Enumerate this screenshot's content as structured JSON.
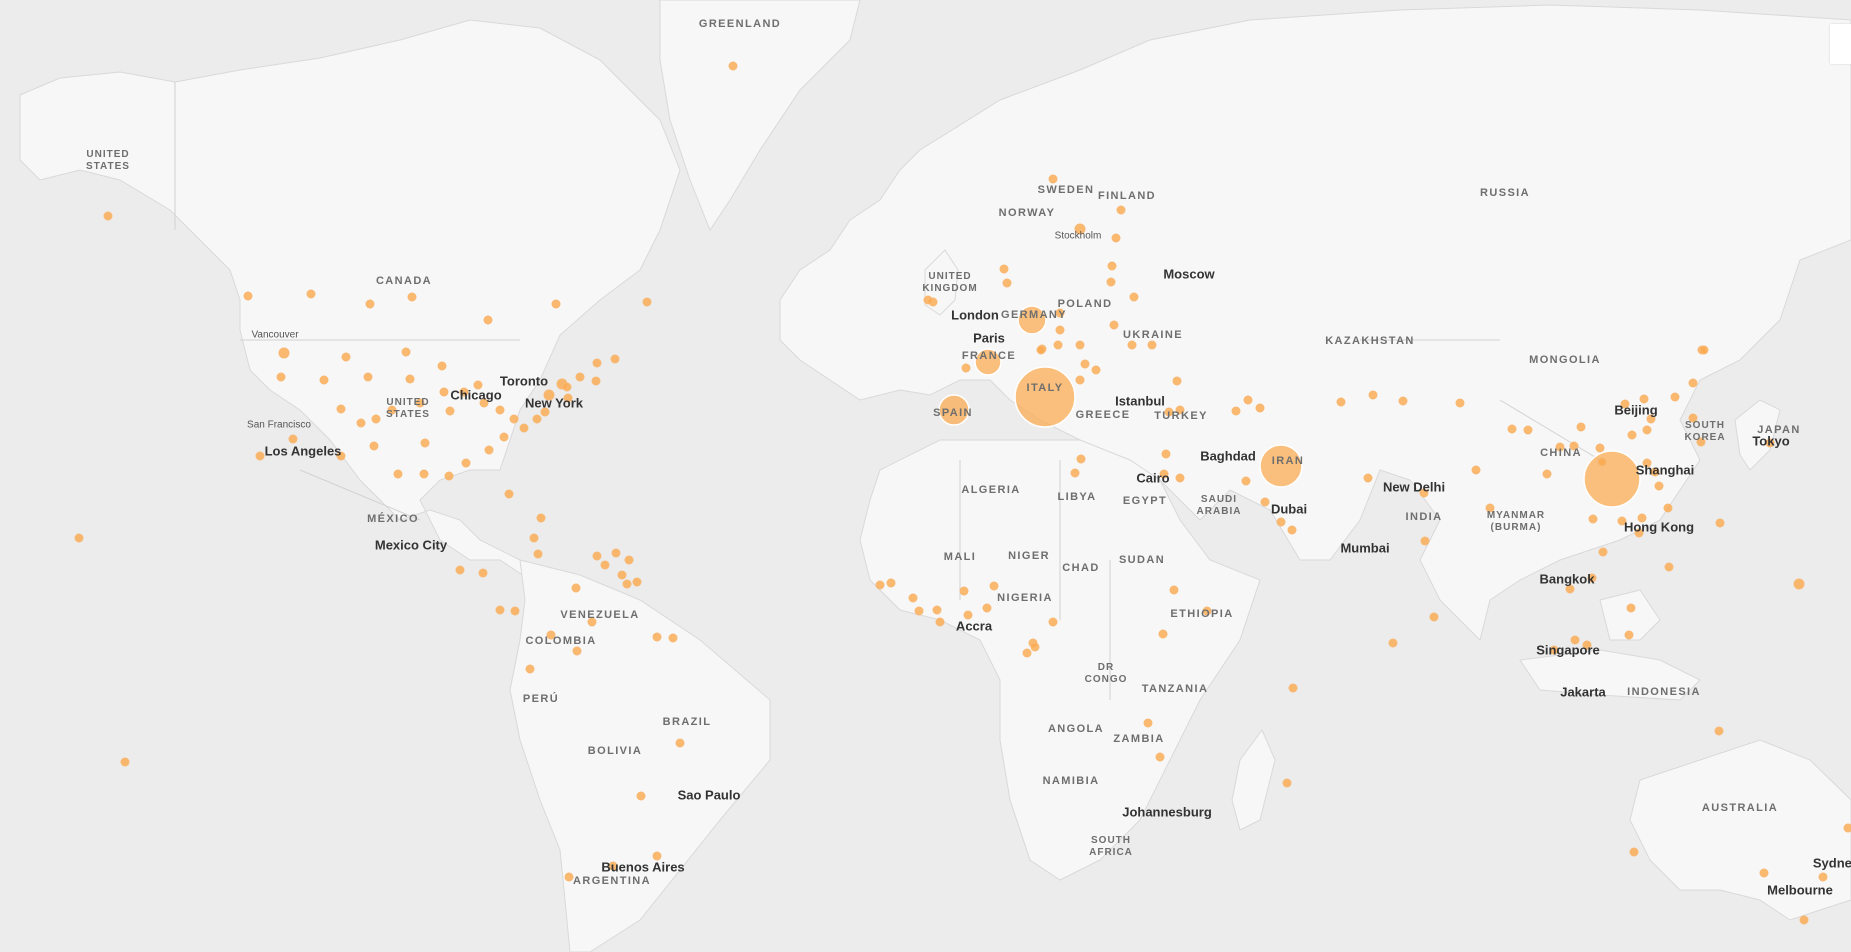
{
  "map": {
    "country_labels": [
      "GREENLAND",
      "UNITED\nSTATES",
      "CANADA",
      "UNITED\nSTATES",
      "MÉXICO",
      "VENEZUELA",
      "COLOMBIA",
      "PERÚ",
      "BRAZIL",
      "BOLIVIA",
      "ARGENTINA",
      "SWEDEN",
      "FINLAND",
      "NORWAY",
      "UNITED\nKINGDOM",
      "GERMANY",
      "POLAND",
      "UKRAINE",
      "FRANCE",
      "SPAIN",
      "ITALY",
      "GREECE",
      "TURKEY",
      "RUSSIA",
      "KAZAKHSTAN",
      "MONGOLIA",
      "IRAN",
      "ALGERIA",
      "LIBYA",
      "EGYPT",
      "SAUDI\nARABIA",
      "MALI",
      "NIGER",
      "CHAD",
      "SUDAN",
      "NIGERIA",
      "ETHIOPIA",
      "DR\nCONGO",
      "TANZANIA",
      "ANGOLA",
      "ZAMBIA",
      "NAMIBIA",
      "SOUTH\nAFRICA",
      "INDIA",
      "CHINA",
      "SOUTH\nKOREA",
      "JAPAN",
      "MYANMAR\n(BURMA)",
      "INDONESIA",
      "AUSTRALIA"
    ],
    "city_labels": [
      "Vancouver",
      "San Francisco",
      "Los Angeles",
      "Chicago",
      "Toronto",
      "New York",
      "Mexico City",
      "Sao Paulo",
      "Buenos Aires",
      "London",
      "Paris",
      "Stockholm",
      "Moscow",
      "Istanbul",
      "Baghdad",
      "Cairo",
      "Dubai",
      "Accra",
      "Johannesburg",
      "New Delhi",
      "Mumbai",
      "Beijing",
      "Shanghai",
      "Hong Kong",
      "Tokyo",
      "Bangkok",
      "Singapore",
      "Jakarta",
      "Sydney",
      "Melbourne"
    ],
    "colors": {
      "water": "#ececec",
      "land": "#f7f7f7",
      "border": "#cfcfcf",
      "marker": "#fba94c"
    }
  }
}
